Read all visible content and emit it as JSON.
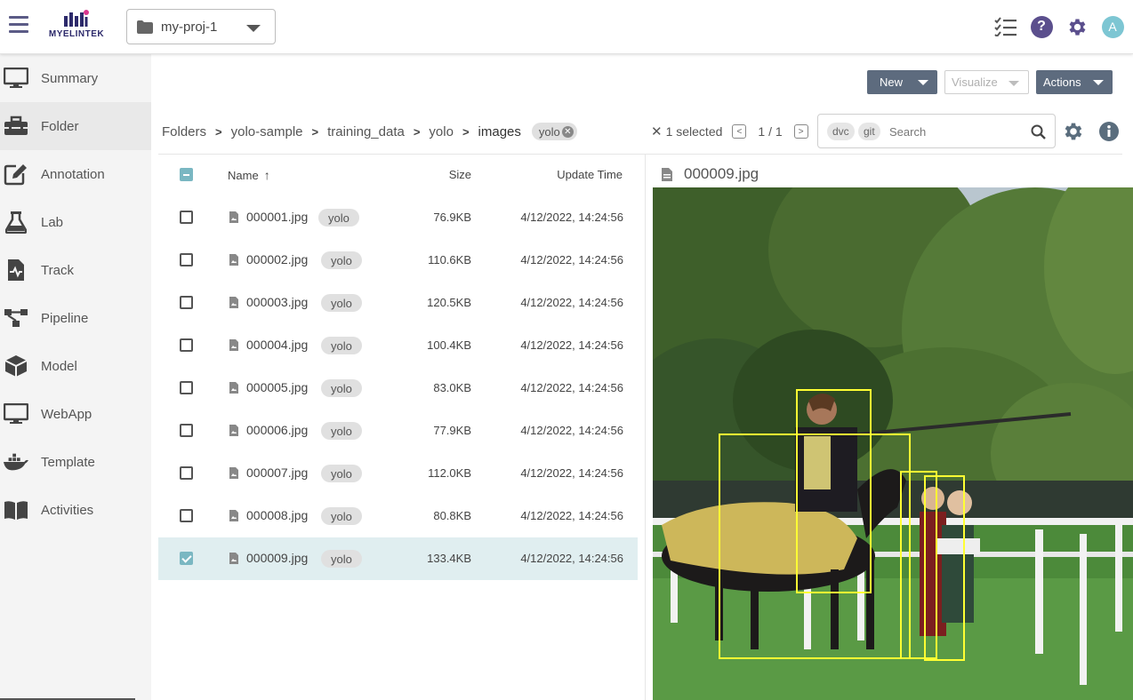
{
  "header": {
    "logo_text": "MYELINTEK",
    "project": "my-proj-1"
  },
  "sidebar": {
    "items": [
      {
        "label": "Summary",
        "icon": "monitor-icon"
      },
      {
        "label": "Folder",
        "icon": "toolbox-icon",
        "active": true
      },
      {
        "label": "Annotation",
        "icon": "edit-icon"
      },
      {
        "label": "Lab",
        "icon": "flask-icon"
      },
      {
        "label": "Track",
        "icon": "track-icon"
      },
      {
        "label": "Pipeline",
        "icon": "pipeline-icon"
      },
      {
        "label": "Model",
        "icon": "cube-icon"
      },
      {
        "label": "WebApp",
        "icon": "monitor-icon"
      },
      {
        "label": "Template",
        "icon": "docker-icon"
      },
      {
        "label": "Activities",
        "icon": "book-icon"
      }
    ]
  },
  "toolbar": {
    "new_label": "New",
    "visualize_label": "Visualize",
    "actions_label": "Actions"
  },
  "breadcrumb": {
    "items": [
      "Folders",
      "yolo-sample",
      "training_data",
      "yolo",
      "images"
    ],
    "tag": "yolo"
  },
  "selection": {
    "text": "1 selected",
    "page": "1 / 1"
  },
  "search": {
    "chips": [
      "dvc",
      "git"
    ],
    "placeholder": "Search"
  },
  "table": {
    "headers": {
      "name": "Name",
      "size": "Size",
      "time": "Update Time"
    },
    "rows": [
      {
        "name": "000001.jpg",
        "tag": "yolo",
        "size": "76.9KB",
        "time": "4/12/2022, 14:24:56",
        "checked": false
      },
      {
        "name": "000002.jpg",
        "tag": "yolo",
        "size": "110.6KB",
        "time": "4/12/2022, 14:24:56",
        "checked": false
      },
      {
        "name": "000003.jpg",
        "tag": "yolo",
        "size": "120.5KB",
        "time": "4/12/2022, 14:24:56",
        "checked": false
      },
      {
        "name": "000004.jpg",
        "tag": "yolo",
        "size": "100.4KB",
        "time": "4/12/2022, 14:24:56",
        "checked": false
      },
      {
        "name": "000005.jpg",
        "tag": "yolo",
        "size": "83.0KB",
        "time": "4/12/2022, 14:24:56",
        "checked": false
      },
      {
        "name": "000006.jpg",
        "tag": "yolo",
        "size": "77.9KB",
        "time": "4/12/2022, 14:24:56",
        "checked": false
      },
      {
        "name": "000007.jpg",
        "tag": "yolo",
        "size": "112.0KB",
        "time": "4/12/2022, 14:24:56",
        "checked": false
      },
      {
        "name": "000008.jpg",
        "tag": "yolo",
        "size": "80.8KB",
        "time": "4/12/2022, 14:24:56",
        "checked": false
      },
      {
        "name": "000009.jpg",
        "tag": "yolo",
        "size": "133.4KB",
        "time": "4/12/2022, 14:24:56",
        "checked": true
      }
    ]
  },
  "preview": {
    "filename": "000009.jpg"
  },
  "colors": {
    "accent": "#5b4f8d",
    "button_dark": "#5d6b7e",
    "checkbox_teal": "#7ab7c2",
    "selected_row": "#e0eef0",
    "bbox": "#ffff33"
  }
}
